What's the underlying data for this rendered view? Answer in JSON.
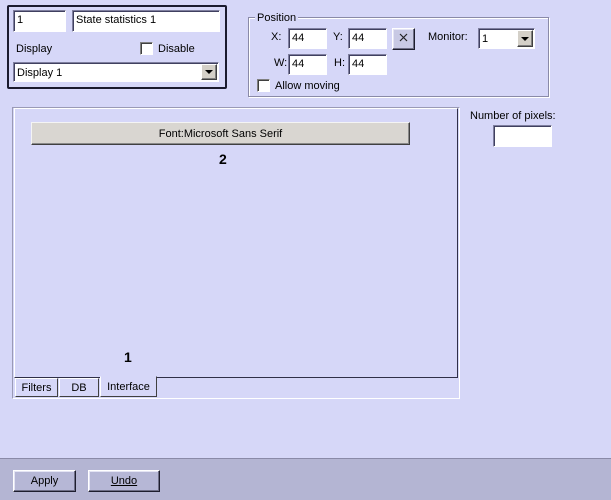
{
  "object": {
    "id_value": "1",
    "name_value": "State statistics 1",
    "display_label": "Display",
    "disable_label": "Disable",
    "disable_checked": false,
    "display_select_value": "Display 1"
  },
  "position": {
    "group_label": "Position",
    "x_label": "X:",
    "x_value": "44",
    "y_label": "Y:",
    "y_value": "44",
    "w_label": "W:",
    "w_value": "44",
    "h_label": "H:",
    "h_value": "44",
    "monitor_label": "Monitor:",
    "monitor_value": "1",
    "allow_moving_label": "Allow moving",
    "allow_moving_checked": false,
    "reset_icon": "close-x-icon"
  },
  "pixels": {
    "label": "Number of pixels:",
    "value": ""
  },
  "preview": {
    "font_button_label": "Font:Microsoft Sans Serif",
    "callout_2": "2",
    "callout_1": "1"
  },
  "tabs": [
    {
      "label": "Filters",
      "active": false
    },
    {
      "label": "DB",
      "active": false
    },
    {
      "label": "Interface",
      "active": true
    }
  ],
  "footer": {
    "apply_label": "Apply",
    "undo_label": "Undo"
  },
  "colors": {
    "background": "#d6d7f8",
    "footer": "#b4b5d3",
    "button": "#b6b7d6",
    "selection_frame": "#1a1a2e"
  }
}
